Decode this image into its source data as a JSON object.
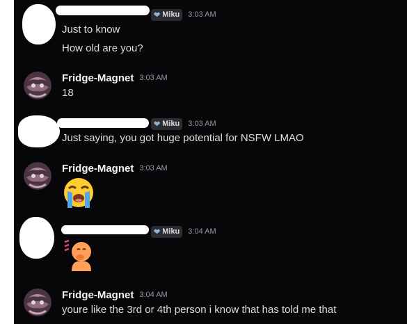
{
  "messages": [
    {
      "author": "",
      "tag": "Miku",
      "time": "3:03 AM",
      "lines": [
        "Just to know",
        "How old are you?"
      ]
    },
    {
      "author": "Fridge-Magnet",
      "time": "3:03 AM",
      "lines": [
        "18"
      ]
    },
    {
      "author": "",
      "tag": "Miku",
      "time": "3:03 AM",
      "lines": [
        "Just saying, you got huge potential for NSFW LMAO"
      ]
    },
    {
      "author": "Fridge-Magnet",
      "time": "3:03 AM",
      "emoji": "loudly-crying-face"
    },
    {
      "author": "",
      "tag": "Miku",
      "time": "3:04 AM",
      "emoji": "face-with-hand-over-mouth-emoji-sticker"
    },
    {
      "author": "Fridge-Magnet",
      "time": "3:04 AM",
      "lines": [
        "youre like the 3rd or 4th person i know that has told me that"
      ]
    }
  ],
  "colors": {
    "background": "#070709",
    "username": "#f2f3f5",
    "text": "#dbdee1",
    "timestamp": "#949ba4",
    "tag_background": "#2b2d31"
  }
}
